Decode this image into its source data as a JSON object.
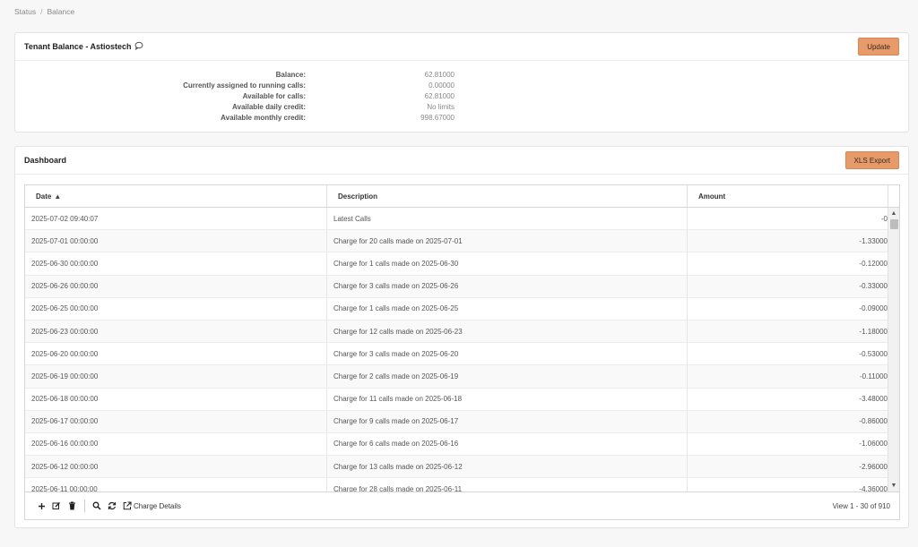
{
  "breadcrumb": {
    "items": [
      "Status",
      "Balance"
    ],
    "separator": "/"
  },
  "balance_panel": {
    "title": "Tenant Balance - Astiostech",
    "update_label": "Update",
    "rows": [
      {
        "label": "Balance:",
        "value": "62.81000"
      },
      {
        "label": "Currently assigned to running calls:",
        "value": "0.00000"
      },
      {
        "label": "Available for calls:",
        "value": "62.81000"
      },
      {
        "label": "Available daily credit:",
        "value": "No limits"
      },
      {
        "label": "Available monthly credit:",
        "value": "998.67000"
      }
    ]
  },
  "dashboard": {
    "title": "Dashboard",
    "export_label": "XLS Export",
    "columns": {
      "date": "Date",
      "description": "Description",
      "amount": "Amount"
    },
    "sort_indicator": "▲",
    "rows": [
      {
        "date": "2025-07-02 09:40:07",
        "description": "Latest Calls",
        "amount": "-0"
      },
      {
        "date": "2025-07-01 00:00:00",
        "description": "Charge for 20 calls made on 2025-07-01",
        "amount": "-1.33000"
      },
      {
        "date": "2025-06-30 00:00:00",
        "description": "Charge for 1 calls made on 2025-06-30",
        "amount": "-0.12000"
      },
      {
        "date": "2025-06-26 00:00:00",
        "description": "Charge for 3 calls made on 2025-06-26",
        "amount": "-0.33000"
      },
      {
        "date": "2025-06-25 00:00:00",
        "description": "Charge for 1 calls made on 2025-06-25",
        "amount": "-0.09000"
      },
      {
        "date": "2025-06-23 00:00:00",
        "description": "Charge for 12 calls made on 2025-06-23",
        "amount": "-1.18000"
      },
      {
        "date": "2025-06-20 00:00:00",
        "description": "Charge for 3 calls made on 2025-06-20",
        "amount": "-0.53000"
      },
      {
        "date": "2025-06-19 00:00:00",
        "description": "Charge for 2 calls made on 2025-06-19",
        "amount": "-0.11000"
      },
      {
        "date": "2025-06-18 00:00:00",
        "description": "Charge for 11 calls made on 2025-06-18",
        "amount": "-3.48000"
      },
      {
        "date": "2025-06-17 00:00:00",
        "description": "Charge for 9 calls made on 2025-06-17",
        "amount": "-0.86000"
      },
      {
        "date": "2025-06-16 00:00:00",
        "description": "Charge for 6 calls made on 2025-06-16",
        "amount": "-1.06000"
      },
      {
        "date": "2025-06-12 00:00:00",
        "description": "Charge for 13 calls made on 2025-06-12",
        "amount": "-2.96000"
      },
      {
        "date": "2025-06-11 00:00:00",
        "description": "Charge for 28 calls made on 2025-06-11",
        "amount": "-4.36000"
      }
    ],
    "pager": {
      "icons": [
        "plus-icon",
        "edit-icon",
        "trash-icon",
        "search-icon",
        "refresh-icon",
        "external-link-icon"
      ],
      "charge_details_label": "Charge Details",
      "view_info": "View 1 - 30 of 910"
    }
  },
  "colors": {
    "accent_button": "#e79a6a",
    "page_bg": "#f7f7f7"
  }
}
